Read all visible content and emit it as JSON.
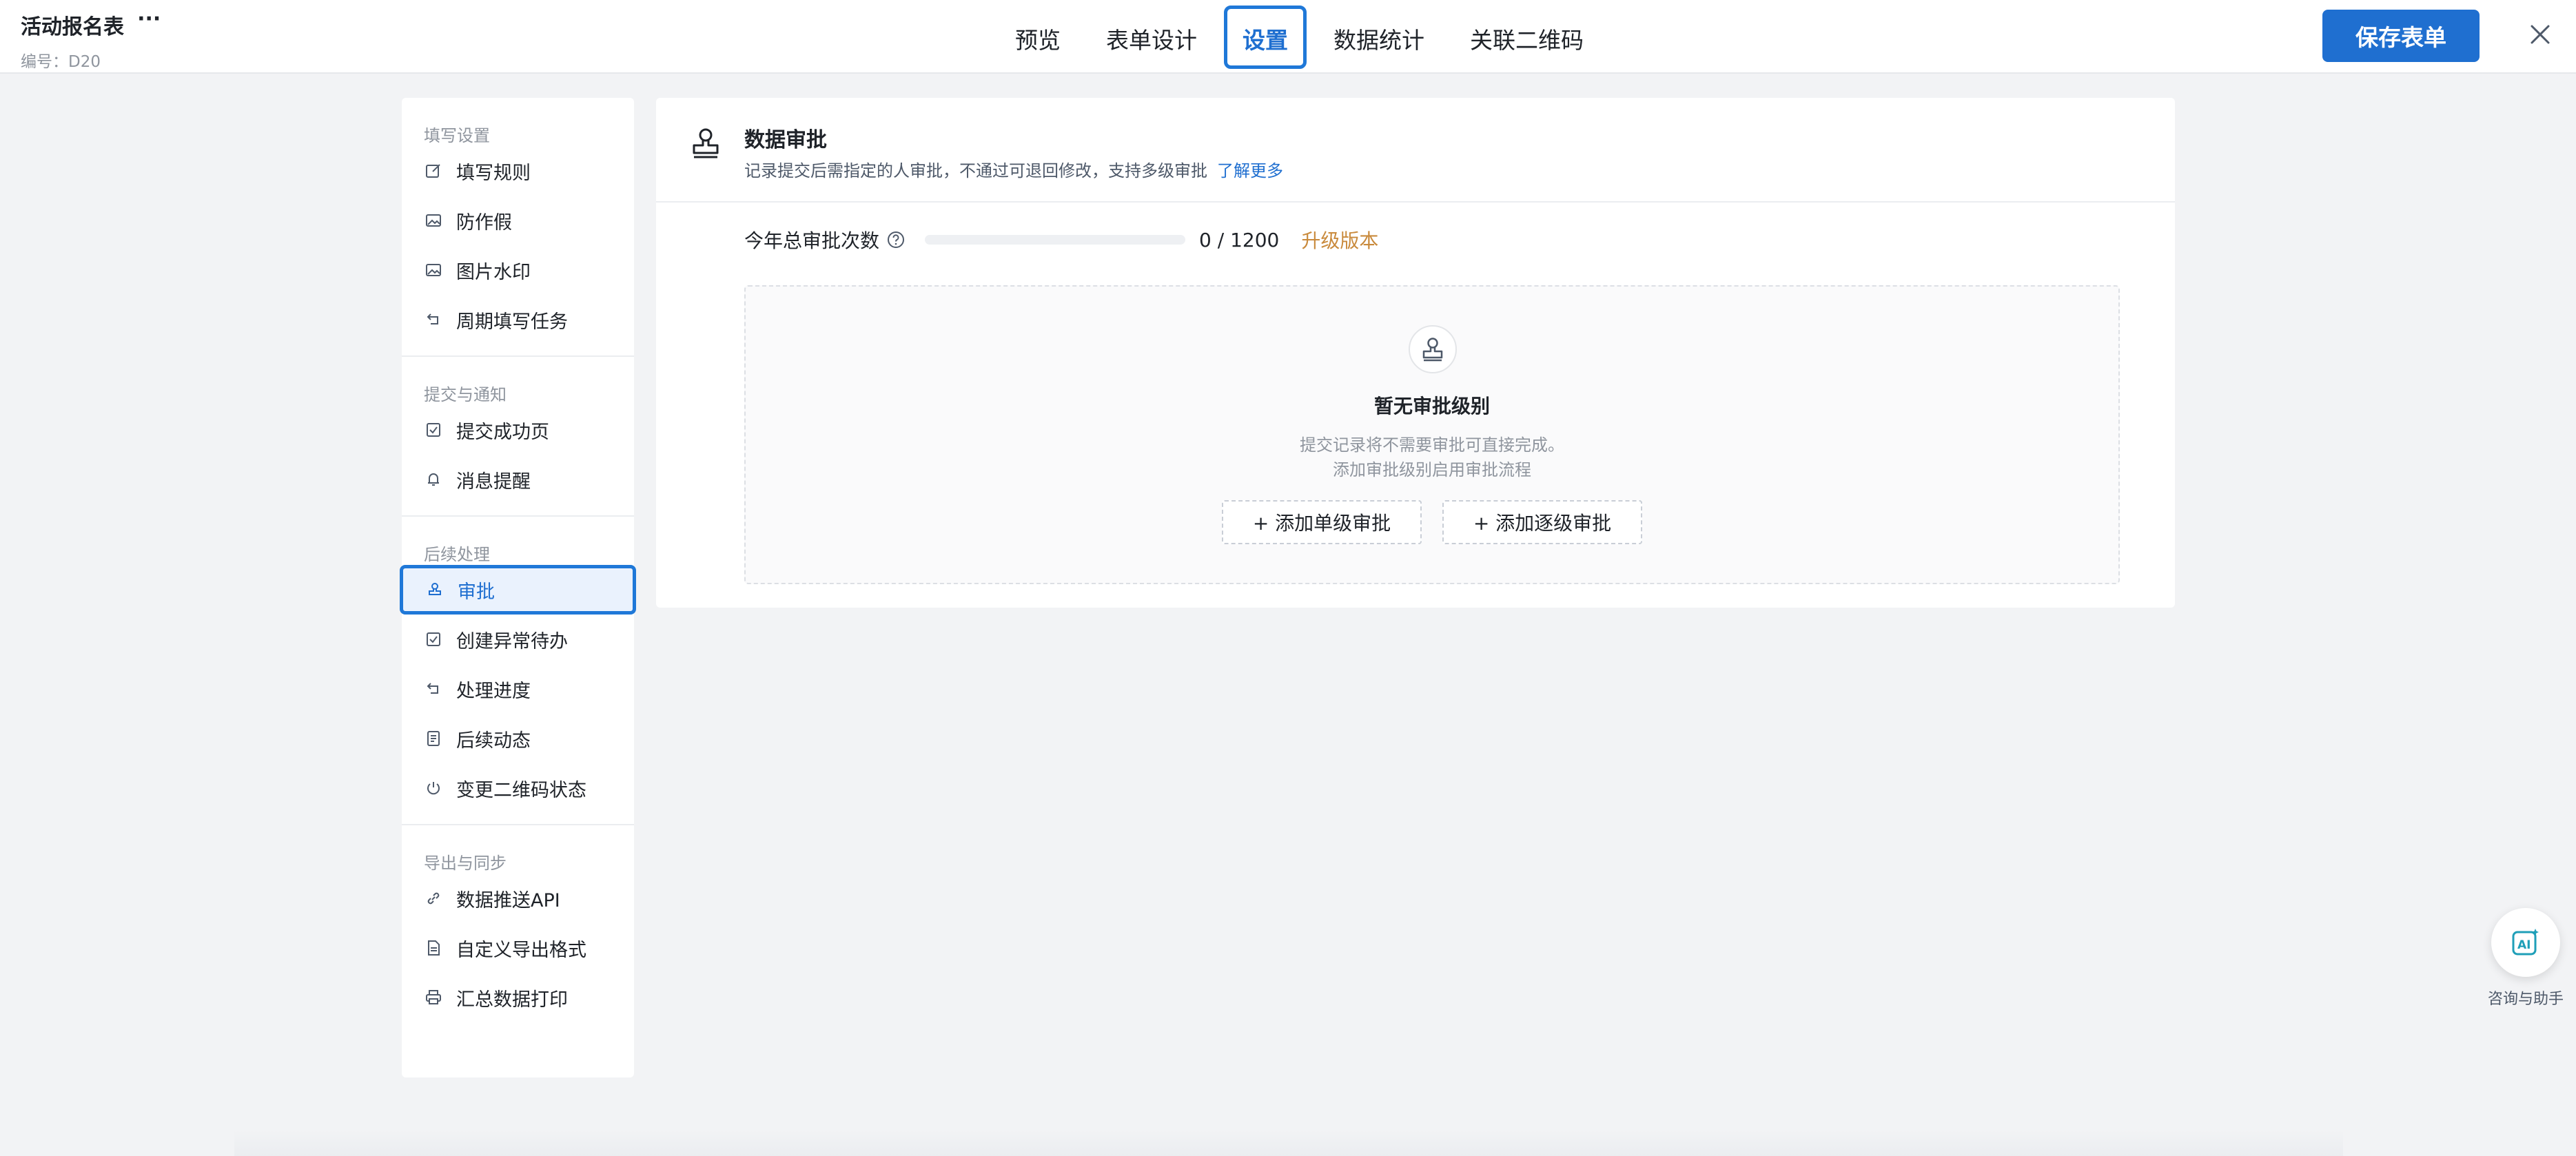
{
  "header": {
    "title": "活动报名表",
    "more": "···",
    "code": "编号：D20",
    "tabs": [
      {
        "label": "预览"
      },
      {
        "label": "表单设计"
      },
      {
        "label": "设置"
      },
      {
        "label": "数据统计"
      },
      {
        "label": "关联二维码"
      }
    ],
    "active_tab": "设置",
    "save_label": "保存表单"
  },
  "sidebar": {
    "groups": [
      {
        "title": "填写设置",
        "items": [
          {
            "label": "填写规则",
            "icon": "edit-icon"
          },
          {
            "label": "防作假",
            "icon": "image-icon"
          },
          {
            "label": "图片水印",
            "icon": "image-icon"
          },
          {
            "label": "周期填写任务",
            "icon": "cycle-icon"
          }
        ]
      },
      {
        "title": "提交与通知",
        "items": [
          {
            "label": "提交成功页",
            "icon": "check-page-icon"
          },
          {
            "label": "消息提醒",
            "icon": "bell-icon"
          }
        ]
      },
      {
        "title": "后续处理",
        "items": [
          {
            "label": "审批",
            "icon": "stamp-icon"
          },
          {
            "label": "创建异常待办",
            "icon": "todo-icon"
          },
          {
            "label": "处理进度",
            "icon": "cycle-icon"
          },
          {
            "label": "后续动态",
            "icon": "doc-icon"
          },
          {
            "label": "变更二维码状态",
            "icon": "power-icon"
          }
        ]
      },
      {
        "title": "导出与同步",
        "items": [
          {
            "label": "数据推送API",
            "icon": "link-icon"
          },
          {
            "label": "自定义导出格式",
            "icon": "file-icon"
          },
          {
            "label": "汇总数据打印",
            "icon": "printer-icon"
          }
        ]
      }
    ],
    "active_item": "审批"
  },
  "panel": {
    "title": "数据审批",
    "description": "记录提交后需指定的人审批，不通过可退回修改，支持多级审批",
    "learn_more": "了解更多",
    "quota_label": "今年总审批次数",
    "quota_used": 0,
    "quota_total": 1200,
    "quota_text": "0 / 1200",
    "upgrade": "升级版本",
    "empty_title": "暂无审批级别",
    "empty_desc_1": "提交记录将不需要审批可直接完成。",
    "empty_desc_2": "添加审批级别启用审批流程",
    "add_single": "+ 添加单级审批",
    "add_multi": "+ 添加逐级审批"
  },
  "assistant": {
    "label": "咨询与助手"
  },
  "colors": {
    "accent": "#1f6fd0",
    "upgrade": "#c98a3c",
    "background": "#f2f3f5"
  }
}
